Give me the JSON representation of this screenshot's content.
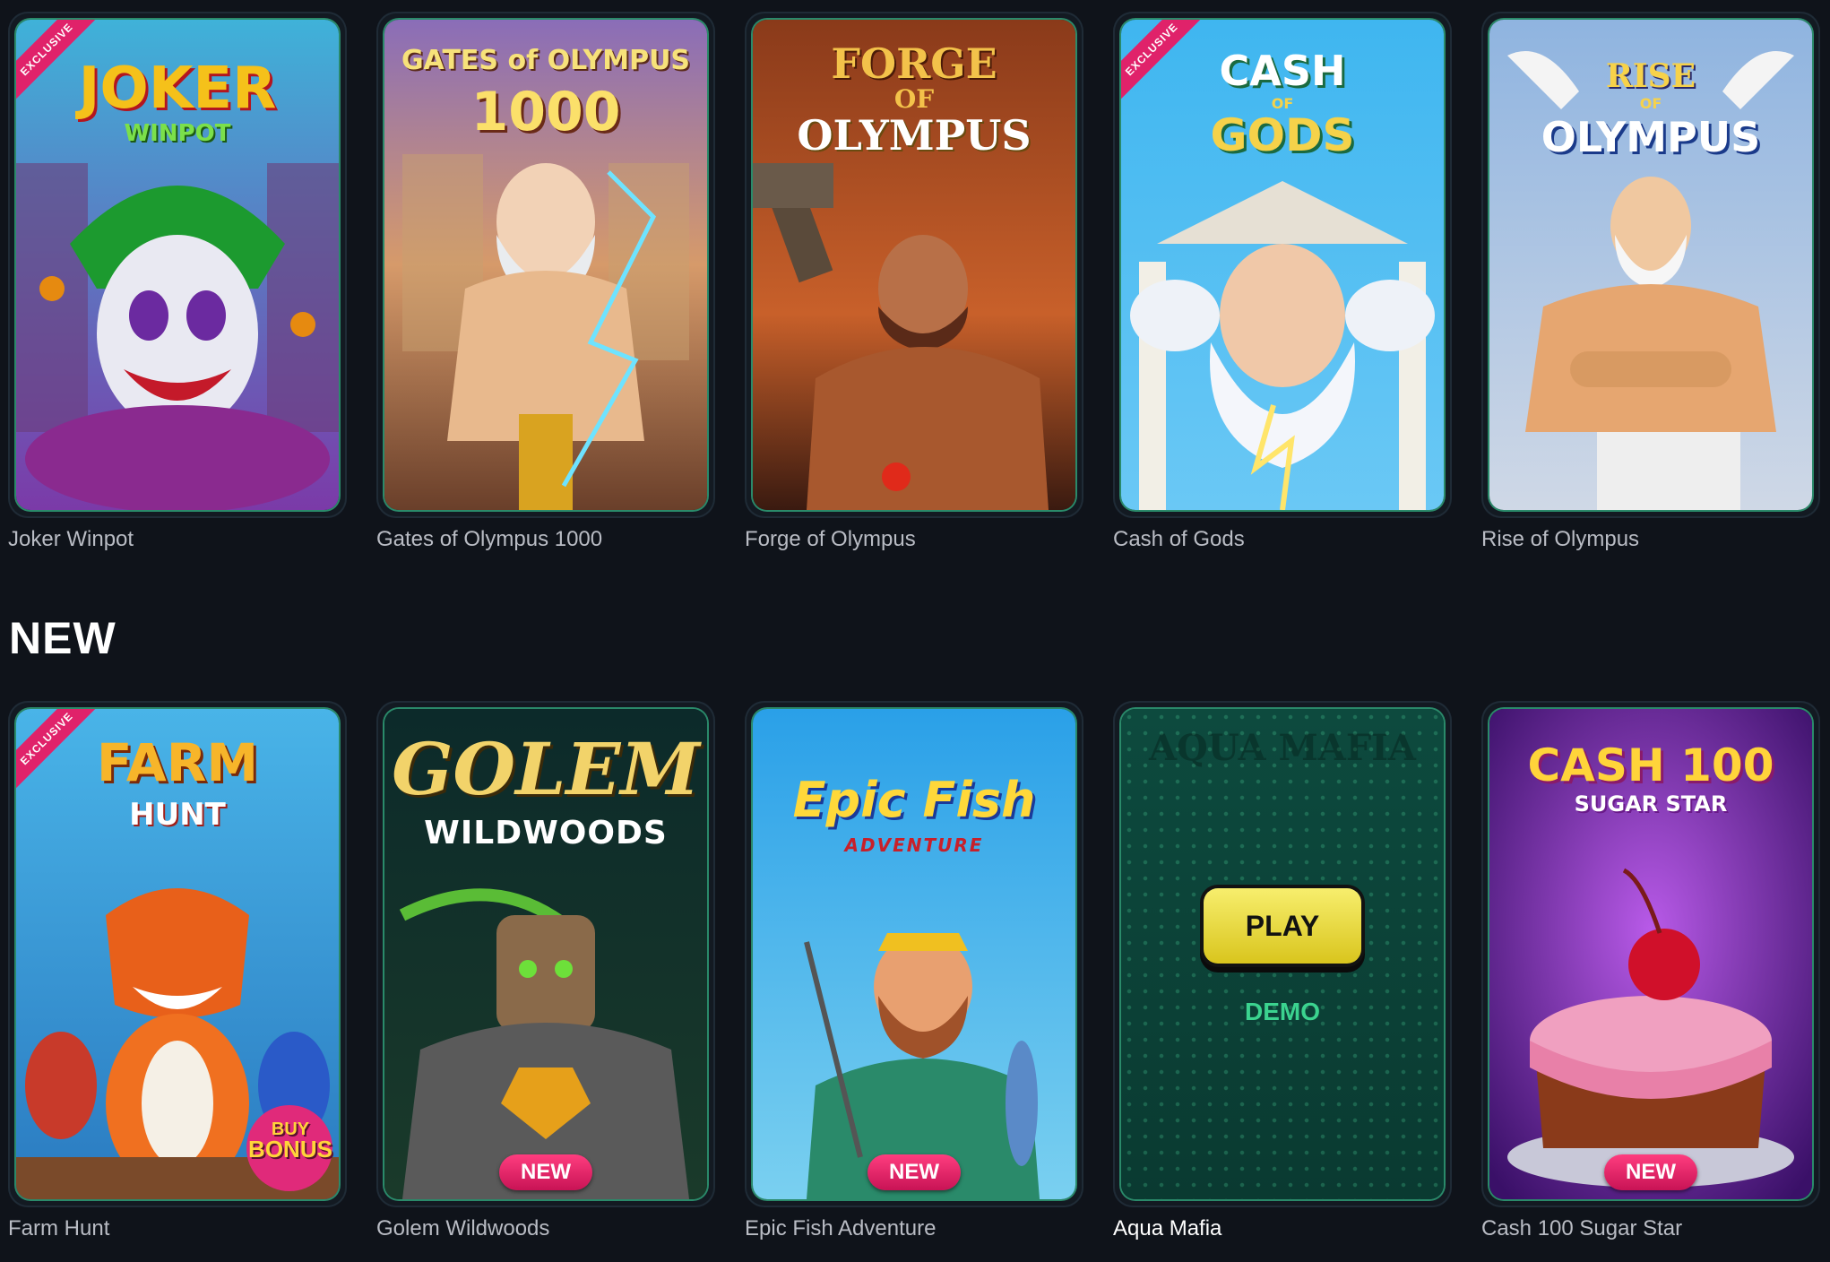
{
  "section_top": {
    "games": [
      {
        "name": "Joker Winpot",
        "logo_line1": "JOKER",
        "logo_line2": "WINPOT",
        "exclusive": "EXCLUSIVE"
      },
      {
        "name": "Gates of Olympus 1000",
        "logo_line1": "GATES of OLYMPUS",
        "logo_line2": "1000"
      },
      {
        "name": "Forge of Olympus",
        "logo_line1": "FORGE",
        "logo_line2": "OF",
        "logo_line3": "OLYMPUS"
      },
      {
        "name": "Cash of Gods",
        "logo_line1": "CASH",
        "logo_line2": "OF",
        "logo_line3": "GODS",
        "exclusive": "EXCLUSIVE"
      },
      {
        "name": "Rise of Olympus",
        "logo_line1": "RISE",
        "logo_line2": "OF",
        "logo_line3": "OLYMPUS"
      }
    ]
  },
  "section_new": {
    "title": "NEW",
    "games": [
      {
        "name": "Farm Hunt",
        "logo_line1": "FARM",
        "logo_line2": "HUNT",
        "exclusive": "EXCLUSIVE",
        "bonus_line1": "BUY",
        "bonus_line2": "BONUS"
      },
      {
        "name": "Golem Wildwoods",
        "logo_line1": "GOLEM",
        "logo_line2": "WILDWOODS",
        "badge": "NEW"
      },
      {
        "name": "Epic Fish Adventure",
        "logo_line1": "Epic Fish",
        "logo_line2": "ADVENTURE",
        "badge": "NEW"
      },
      {
        "name": "Aqua Mafia",
        "logo_line1": "AQUA MAFIA",
        "play": "PLAY",
        "demo": "DEMO"
      },
      {
        "name": "Cash 100 Sugar Star",
        "logo_line1": "CASH 100",
        "logo_line2": "SUGAR STAR",
        "badge": "NEW"
      }
    ]
  },
  "colors": {
    "background": "#0f131a",
    "accent_green": "#3bd38f",
    "badge_pink": "#e0226a",
    "play_yellow": "#e9dc3a"
  }
}
